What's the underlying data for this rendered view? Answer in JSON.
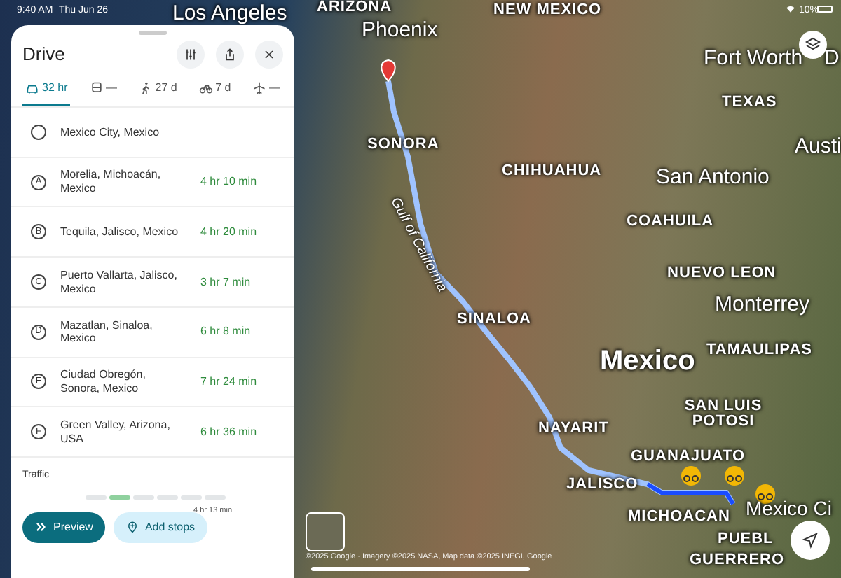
{
  "status_bar": {
    "time": "9:40 AM",
    "date": "Thu Jun 26",
    "battery": "10%"
  },
  "map": {
    "labels": [
      {
        "text": "Los Angeles",
        "kind": "city"
      },
      {
        "text": "ARIZONA",
        "kind": "region"
      },
      {
        "text": "Phoenix",
        "kind": "city"
      },
      {
        "text": "NEW MEXICO",
        "kind": "region"
      },
      {
        "text": "Fort Worth",
        "kind": "city"
      },
      {
        "text": "D",
        "kind": "city"
      },
      {
        "text": "TEXAS",
        "kind": "region"
      },
      {
        "text": "Austi",
        "kind": "city"
      },
      {
        "text": "SONORA",
        "kind": "region"
      },
      {
        "text": "CHIHUAHUA",
        "kind": "region"
      },
      {
        "text": "San Antonio",
        "kind": "city"
      },
      {
        "text": "COAHUILA",
        "kind": "region"
      },
      {
        "text": "Gulf of California",
        "kind": "water"
      },
      {
        "text": "NUEVO LEON",
        "kind": "region"
      },
      {
        "text": "Monterrey",
        "kind": "city"
      },
      {
        "text": "SINALOA",
        "kind": "region"
      },
      {
        "text": "TAMAULIPAS",
        "kind": "region"
      },
      {
        "text": "Mexico",
        "kind": "country"
      },
      {
        "text": "SAN LUIS POTOSI",
        "kind": "region"
      },
      {
        "text": "NAYARIT",
        "kind": "region"
      },
      {
        "text": "GUANAJUATO",
        "kind": "region"
      },
      {
        "text": "JALISCO",
        "kind": "region"
      },
      {
        "text": "MICHOACAN",
        "kind": "region"
      },
      {
        "text": "Mexico Ci",
        "kind": "city"
      },
      {
        "text": "PUEBL",
        "kind": "region"
      },
      {
        "text": "GUERRERO",
        "kind": "region"
      }
    ],
    "attribution": "©2025 Google · Imagery ©2025 NASA, Map data ©2025 INEGI, Google"
  },
  "panel": {
    "title": "Drive",
    "tabs": [
      {
        "kind": "car",
        "label": "32 hr",
        "selected": true
      },
      {
        "kind": "transit",
        "label": "—",
        "selected": false
      },
      {
        "kind": "walk",
        "label": "27 d",
        "selected": false
      },
      {
        "kind": "bike",
        "label": "7 d",
        "selected": false
      },
      {
        "kind": "plane",
        "label": "—",
        "selected": false
      }
    ],
    "stops": [
      {
        "kind": "origin",
        "place": "Mexico City, Mexico"
      },
      {
        "kind": "stop",
        "marker": "A",
        "place": "Morelia, Michoacán, Mexico",
        "duration": "4 hr 10 min"
      },
      {
        "kind": "stop",
        "marker": "B",
        "place": "Tequila, Jalisco, Mexico",
        "duration": "4 hr 20 min"
      },
      {
        "kind": "stop",
        "marker": "C",
        "place": "Puerto Vallarta, Jalisco, Mexico",
        "duration": "3 hr 7 min"
      },
      {
        "kind": "stop",
        "marker": "D",
        "place": "Mazatlan, Sinaloa, Mexico",
        "duration": "6 hr 8 min"
      },
      {
        "kind": "stop",
        "marker": "E",
        "place": "Ciudad Obregón, Sonora, Mexico",
        "duration": "7 hr 24 min"
      },
      {
        "kind": "stop",
        "marker": "F",
        "place": "Green Valley, Arizona, USA",
        "duration": "6 hr 36 min"
      }
    ],
    "traffic": {
      "title": "Traffic",
      "reading": "4 hr 13 min"
    },
    "buttons": [
      {
        "kind": "preview",
        "label": "Preview"
      },
      {
        "kind": "add",
        "label": "Add stops"
      }
    ]
  }
}
